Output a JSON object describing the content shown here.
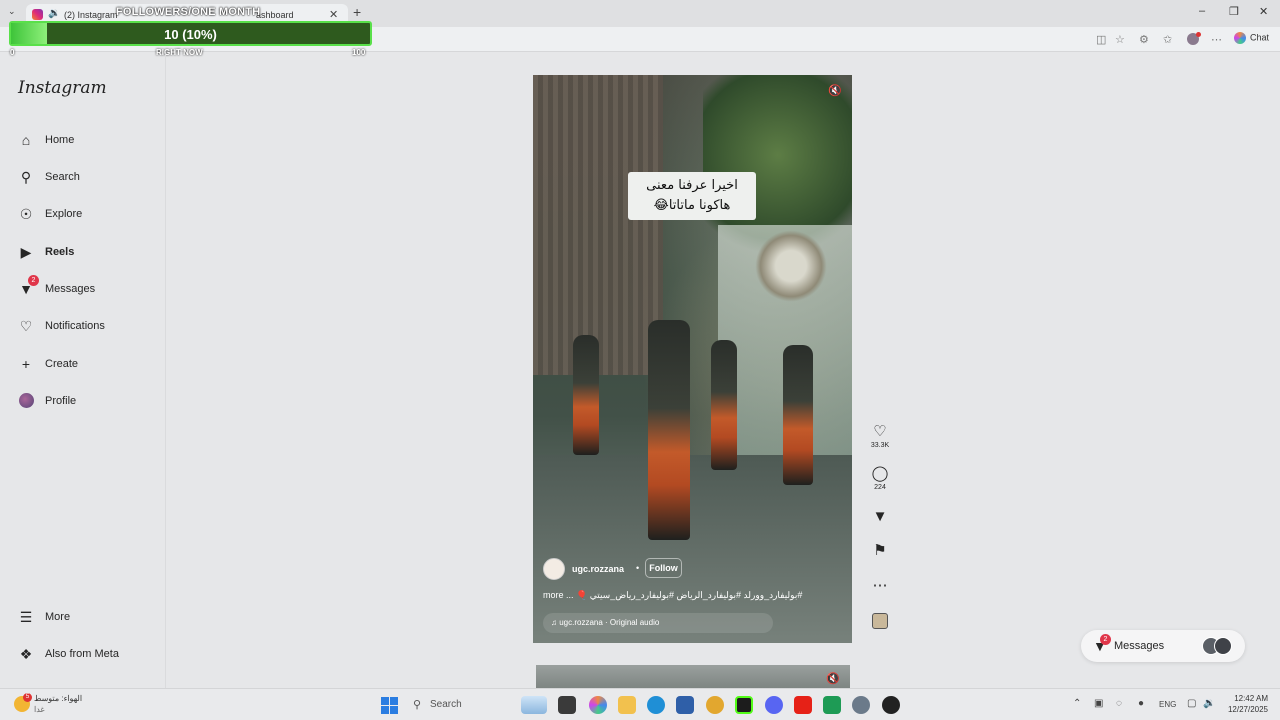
{
  "browser": {
    "tab_title": "(2) Instagram",
    "tab2_fragment": "ashboard",
    "chat_label": "Chat"
  },
  "overlay": {
    "title": "FOLLOWERS/ONE MONTH",
    "value_label": "10 (10%)",
    "progress_fraction": 0.1,
    "min_label": "0",
    "mid_label": "RIGHT NOW",
    "max_label": "100",
    "fill_color": "#59e04a"
  },
  "sidebar": {
    "logo": "Instagram",
    "items": [
      {
        "label": "Home",
        "icon": "home-icon"
      },
      {
        "label": "Search",
        "icon": "search-icon"
      },
      {
        "label": "Explore",
        "icon": "compass-icon"
      },
      {
        "label": "Reels",
        "icon": "reels-icon"
      },
      {
        "label": "Messages",
        "icon": "messenger-icon",
        "badge": "2"
      },
      {
        "label": "Notifications",
        "icon": "heart-icon"
      },
      {
        "label": "Create",
        "icon": "plus-icon"
      },
      {
        "label": "Profile",
        "icon": "avatar"
      }
    ],
    "more": "More",
    "also_from_meta": "Also from Meta"
  },
  "reel": {
    "caption_line1": "اخيرا عرفنا معنى",
    "caption_line2": "هاكونا ماتاتا😂",
    "username": "ugc.rozzana",
    "dot": "•",
    "follow_label": "Follow",
    "tags": "#بوليفارد_وورلد #بوليفارد_الرياض #بوليفارد_رياض_سيتي 🎈 ... more",
    "audio": "ugc.rozzana · Original audio"
  },
  "actions": {
    "likes": "33.3K",
    "comments": "224"
  },
  "messages_bubble": {
    "label": "Messages",
    "badge": "2"
  },
  "taskbar": {
    "weather_line1": "الهواء: متوسط",
    "weather_line2": "غدا",
    "weather_badge": "5",
    "search_placeholder": "Search",
    "lang": "ENG",
    "time": "12:42 AM",
    "date": "12/27/2025"
  }
}
